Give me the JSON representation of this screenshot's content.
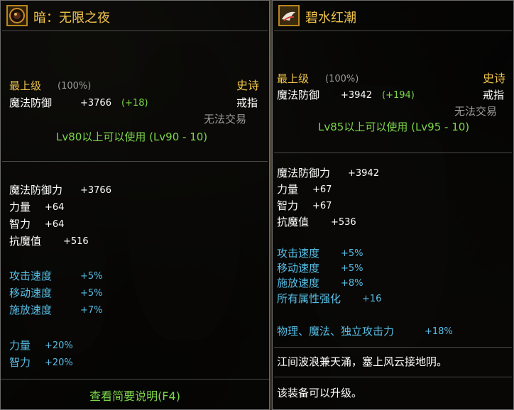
{
  "left": {
    "name": "暗：无限之夜",
    "icon": "dark-ring-icon",
    "tier": "最上级",
    "tier_percent": "(100%)",
    "rarity": "史诗",
    "base_stat_label": "魔法防御",
    "base_stat_value": "+3766",
    "base_stat_bonus": "(+18)",
    "slot": "戒指",
    "trade": "无法交易",
    "level_req": "Lv80以上可以使用 (Lv90 - 10)",
    "stats": [
      {
        "label": "魔法防御力",
        "value": "+3766"
      },
      {
        "label": "力量",
        "value": "+64"
      },
      {
        "label": "智力",
        "value": "+64"
      },
      {
        "label": "抗魔值",
        "value": "+516"
      }
    ],
    "speeds": [
      {
        "label": "攻击速度",
        "value": "+5%"
      },
      {
        "label": "移动速度",
        "value": "+5%"
      },
      {
        "label": "施放速度",
        "value": "+7%"
      }
    ],
    "percent_stats": [
      {
        "label": "力量",
        "value": "+20%"
      },
      {
        "label": "智力",
        "value": "+20%"
      }
    ],
    "footer_button": "查看简要说明(F4)"
  },
  "right": {
    "name": "碧水红潮",
    "icon": "wave-ring-icon",
    "tier": "最上级",
    "tier_percent": "(100%)",
    "rarity": "史诗",
    "base_stat_label": "魔法防御",
    "base_stat_value": "+3942",
    "base_stat_bonus": "(+194)",
    "slot": "戒指",
    "trade": "无法交易",
    "level_req": "Lv85以上可以使用 (Lv95 - 10)",
    "stats": [
      {
        "label": "魔法防御力",
        "value": "+3942"
      },
      {
        "label": "力量",
        "value": "+67"
      },
      {
        "label": "智力",
        "value": "+67"
      },
      {
        "label": "抗魔值",
        "value": "+536"
      }
    ],
    "speeds": [
      {
        "label": "攻击速度",
        "value": "+5%"
      },
      {
        "label": "移动速度",
        "value": "+5%"
      },
      {
        "label": "施放速度",
        "value": "+8%"
      },
      {
        "label": "所有属性强化",
        "value": "+16"
      }
    ],
    "attack_bonus": {
      "label": "物理、魔法、独立攻击力",
      "value": "+18%"
    },
    "flavor": "江间波浪兼天涌，塞上风云接地阴。",
    "upgrade_note": "该装备可以升级。"
  },
  "colors": {
    "gold": "#f0c44a",
    "green": "#7cd64a",
    "cyan": "#57bfe6",
    "grey": "#9b9b9b"
  }
}
